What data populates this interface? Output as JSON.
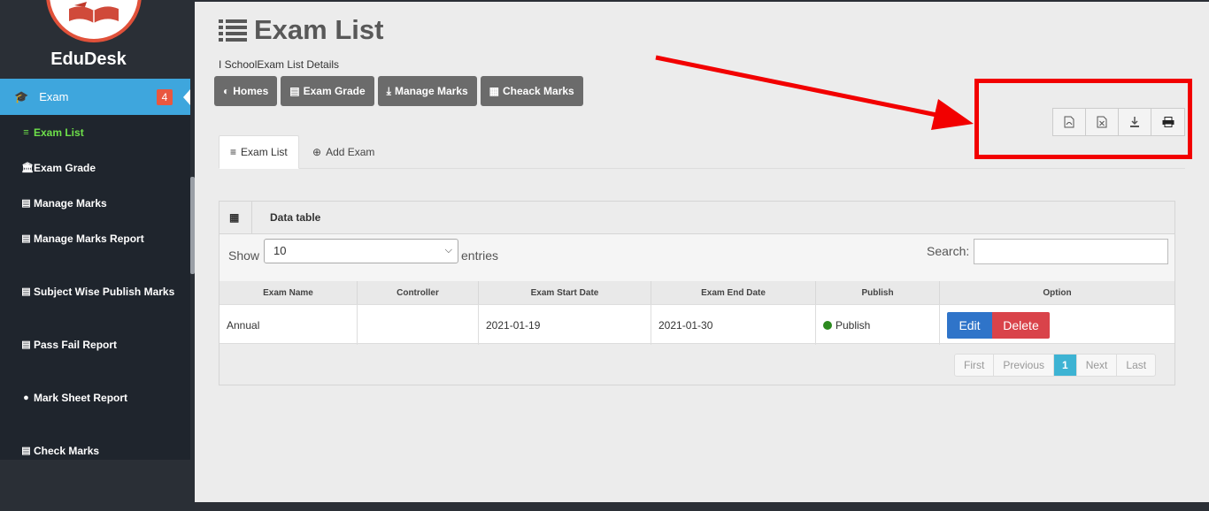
{
  "brand": "EduDesk",
  "sidebar": {
    "section": {
      "label": "Exam",
      "badge": "4"
    },
    "items": [
      {
        "label": "Exam List",
        "icon": "list-icon",
        "active": true
      },
      {
        "label": "Exam Grade",
        "icon": "bank-icon"
      },
      {
        "label": "Manage Marks",
        "icon": "document-icon"
      },
      {
        "label": "Manage Marks Report",
        "icon": "document-icon"
      },
      {
        "label": "Subject Wise Publish Marks",
        "icon": "document-icon"
      },
      {
        "label": "Pass Fail Report",
        "icon": "document-icon"
      },
      {
        "label": "Mark Sheet Report",
        "icon": "circle-icon"
      },
      {
        "label": "Check Marks",
        "icon": "document-icon"
      }
    ]
  },
  "header": {
    "title": "Exam List",
    "breadcrumb": "I SchoolExam List Details"
  },
  "nav_buttons": [
    {
      "label": "Homes",
      "icon": "dashboard-icon"
    },
    {
      "label": "Exam Grade",
      "icon": "id-card-icon"
    },
    {
      "label": "Manage Marks",
      "icon": "download-icon"
    },
    {
      "label": "Cheack Marks",
      "icon": "contact-icon"
    }
  ],
  "export_buttons": [
    "pdf-icon",
    "excel-icon",
    "download-icon",
    "print-icon"
  ],
  "tabs": [
    {
      "label": "Exam List",
      "icon": "list-icon",
      "active": true
    },
    {
      "label": "Add Exam",
      "icon": "plus-circle-icon"
    }
  ],
  "panel": {
    "title": "Data table",
    "show_label": "Show",
    "show_value": "10",
    "entries_label": "entries",
    "search_label": "Search:",
    "search_value": ""
  },
  "table": {
    "columns": [
      "Exam Name",
      "Controller",
      "Exam Start Date",
      "Exam End Date",
      "Publish",
      "Option"
    ],
    "rows": [
      {
        "exam_name": "Annual",
        "controller": "",
        "start": "2021-01-19",
        "end": "2021-01-30",
        "publish": "Publish",
        "edit": "Edit",
        "delete": "Delete"
      }
    ]
  },
  "pagination": [
    "First",
    "Previous",
    "1",
    "Next",
    "Last"
  ],
  "colors": {
    "accent": "#3ea6dd",
    "badge": "#e9573f",
    "active_menu_text": "#6ee04a",
    "annotation_red": "#f20000",
    "edit": "#2f74c9",
    "delete": "#d9434a",
    "page_current": "#3db3d3"
  }
}
